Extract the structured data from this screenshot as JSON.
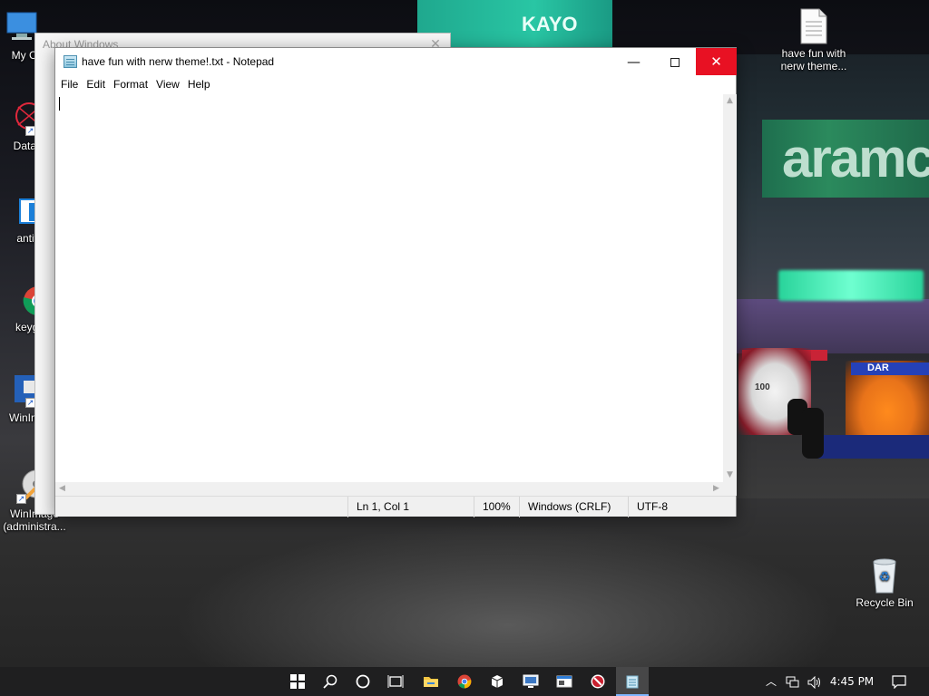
{
  "wallpaper": {
    "banner_text": "KAYO",
    "sponsor_text": "aramco",
    "car_wing_text": "DAR",
    "car_number": "100"
  },
  "desktop": {
    "icons_left": [
      {
        "label": "My Co",
        "icon": "computer-icon"
      },
      {
        "label": "DataW",
        "icon": "datawave-icon"
      },
      {
        "label": "antifa",
        "icon": "app-window-icon"
      },
      {
        "label": "keyge",
        "icon": "chrome-icon"
      },
      {
        "label": "WinImage",
        "icon": "winimage-icon"
      },
      {
        "label": "WinImage (administra...",
        "icon": "winimage-admin-icon"
      }
    ],
    "icon_text_file": {
      "label": "have fun with nerw theme...",
      "icon": "text-file-icon"
    },
    "icon_recycle_bin": {
      "label": "Recycle Bin",
      "icon": "recycle-bin-icon"
    }
  },
  "about_window": {
    "title": "About Windows",
    "close_glyph": "✕"
  },
  "notepad": {
    "title": "have fun with nerw theme!.txt - Notepad",
    "minimize_glyph": "—",
    "close_glyph": "✕",
    "menu": [
      "File",
      "Edit",
      "Format",
      "View",
      "Help"
    ],
    "content": "",
    "status": {
      "position": "Ln 1, Col 1",
      "zoom": "100%",
      "line_ending": "Windows (CRLF)",
      "encoding": "UTF-8"
    }
  },
  "taskbar": {
    "pinned": [
      "start-icon",
      "search-icon",
      "cortana-icon",
      "task-view-icon",
      "file-explorer-icon",
      "chrome-icon",
      "app-package-icon",
      "remote-desktop-icon",
      "app-window-icon",
      "red-circle-app-icon",
      "notepad-icon"
    ],
    "tray": {
      "clock": "4:45 PM"
    }
  }
}
